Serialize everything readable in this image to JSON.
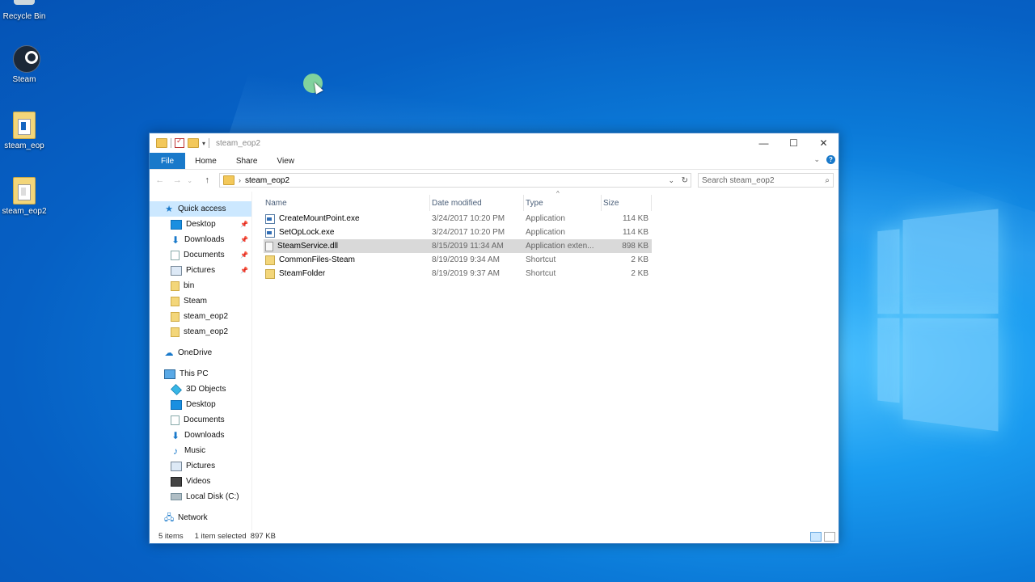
{
  "desktop": {
    "icons": [
      {
        "label": "Recycle Bin",
        "icon": "recycle-bin-icon"
      },
      {
        "label": "Steam",
        "icon": "steam-icon"
      },
      {
        "label": "steam_eop",
        "icon": "folder-icon"
      },
      {
        "label": "steam_eop2",
        "icon": "folder-icon"
      }
    ]
  },
  "window": {
    "title": "steam_eop2",
    "controls": {
      "minimize": "—",
      "maximize": "☐",
      "close": "✕"
    },
    "ribbon": {
      "tabs": [
        "File",
        "Home",
        "Share",
        "View"
      ]
    },
    "address": {
      "path": "steam_eop2",
      "search_placeholder": "Search steam_eop2"
    },
    "nav": {
      "quick_access": "Quick access",
      "quick_items": [
        {
          "label": "Desktop",
          "pinned": true
        },
        {
          "label": "Downloads",
          "pinned": true
        },
        {
          "label": "Documents",
          "pinned": true
        },
        {
          "label": "Pictures",
          "pinned": true
        },
        {
          "label": "bin",
          "pinned": false
        },
        {
          "label": "Steam",
          "pinned": false
        },
        {
          "label": "steam_eop2",
          "pinned": false
        },
        {
          "label": "steam_eop2",
          "pinned": false
        }
      ],
      "onedrive": "OneDrive",
      "this_pc": "This PC",
      "pc_items": [
        "3D Objects",
        "Desktop",
        "Documents",
        "Downloads",
        "Music",
        "Pictures",
        "Videos",
        "Local Disk (C:)"
      ],
      "network": "Network"
    },
    "columns": {
      "name": "Name",
      "date": "Date modified",
      "type": "Type",
      "size": "Size"
    },
    "files": [
      {
        "name": "CreateMountPoint.exe",
        "date": "3/24/2017 10:20 PM",
        "type": "Application",
        "size": "114 KB",
        "kind": "exe"
      },
      {
        "name": "SetOpLock.exe",
        "date": "3/24/2017 10:20 PM",
        "type": "Application",
        "size": "114 KB",
        "kind": "exe"
      },
      {
        "name": "SteamService.dll",
        "date": "8/15/2019 11:34 AM",
        "type": "Application exten...",
        "size": "898 KB",
        "kind": "dll",
        "selected": true
      },
      {
        "name": "CommonFiles-Steam",
        "date": "8/19/2019 9:34 AM",
        "type": "Shortcut",
        "size": "2 KB",
        "kind": "lnk"
      },
      {
        "name": "SteamFolder",
        "date": "8/19/2019 9:37 AM",
        "type": "Shortcut",
        "size": "2 KB",
        "kind": "lnk"
      }
    ],
    "status": {
      "items": "5 items",
      "selection": "1 item selected  897 KB"
    }
  }
}
